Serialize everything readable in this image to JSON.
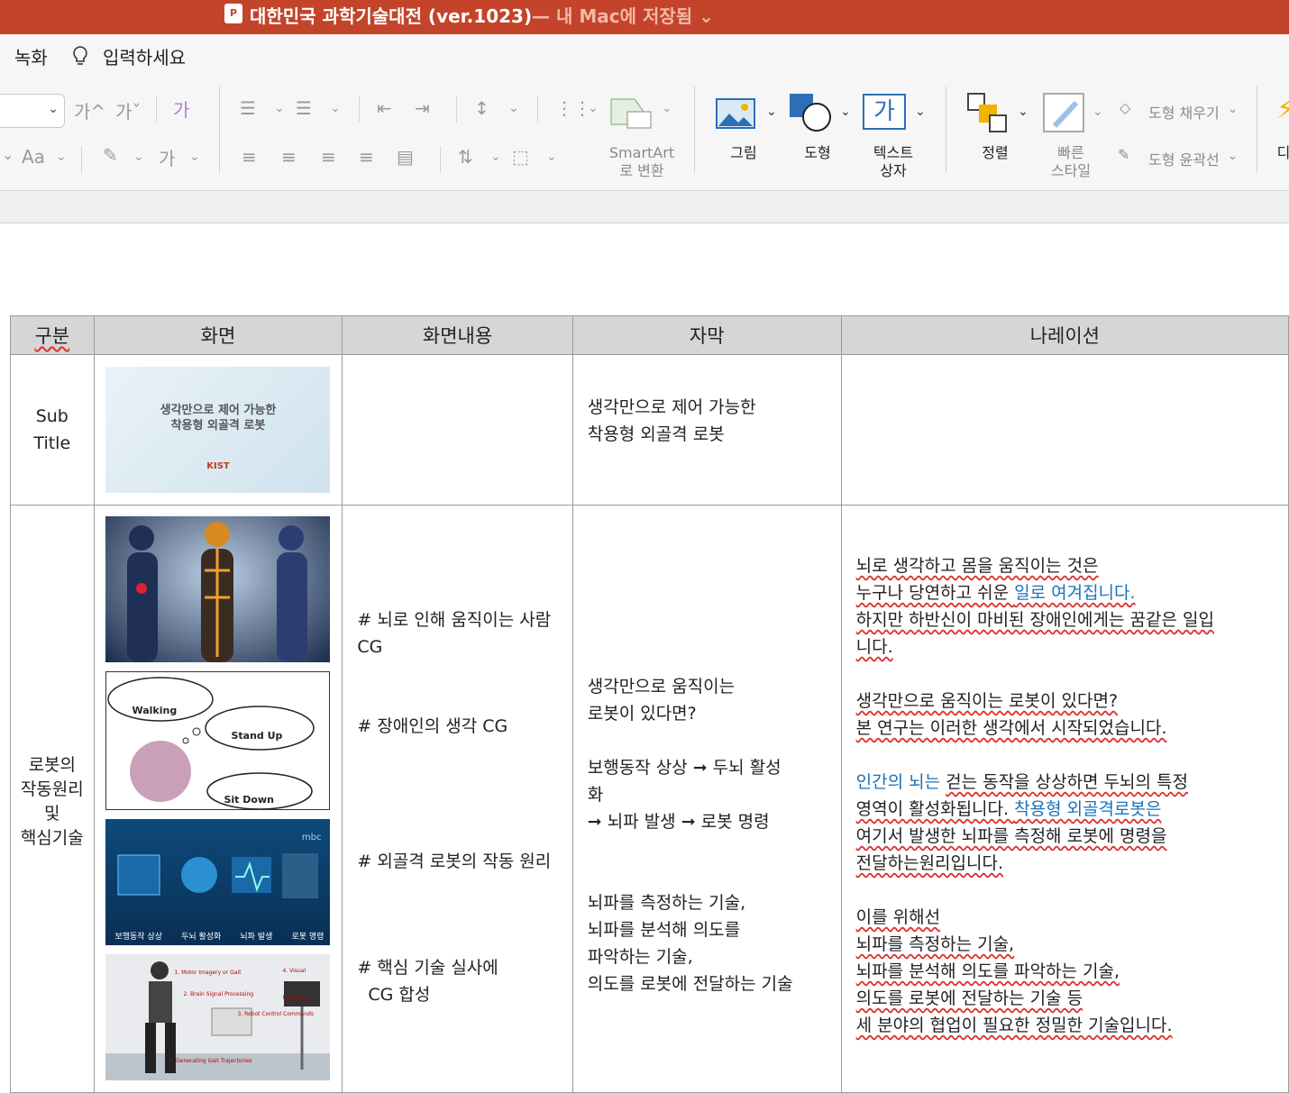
{
  "window": {
    "title": "대한민국 과학기술대전 (ver.1023)",
    "status": "— 내 Mac에 저장됨 ⌄"
  },
  "menu": {
    "record": "녹화",
    "tell_me": "입력하세요"
  },
  "ribbon": {
    "font_size_glyphs": [
      "가^",
      "가ˇ"
    ],
    "aa_label": "Aa",
    "ga_label": "가",
    "smartart": [
      "SmartArt",
      "로 변환"
    ],
    "picture": "그림",
    "shape": "도형",
    "textbox": [
      "텍스트",
      "상자"
    ],
    "textbox_glyph": "가",
    "arrange": "정렬",
    "quick_style": [
      "빠른",
      "스타일"
    ],
    "shape_fill": "도형 채우기",
    "shape_outline": "도형 윤곽선",
    "cut_label": "디"
  },
  "table": {
    "headers": [
      "구분",
      "화면",
      "화면내용",
      "자막",
      "나레이션"
    ],
    "row1": {
      "category": [
        "Sub",
        "Title"
      ],
      "thumb_text": [
        "생각만으로 제어 가능한",
        "착용형 외골격 로봇"
      ],
      "thumb_logo": "KIST",
      "subtitle": [
        "생각만으로 제어 가능한",
        "착용형 외골격 로봇"
      ]
    },
    "row2": {
      "category": [
        "로봇의",
        "작동원리",
        "및",
        "핵심기술"
      ],
      "thumb2_labels": [
        "Walking",
        "Stand Up",
        "Sit Down"
      ],
      "thumb3_labels": [
        "보행동작 상상",
        "두뇌 활성화",
        "뇌파 발생",
        "로봇 명령"
      ],
      "thumb3_brand": "mbc",
      "thumb4_labels": [
        "1. Motor Imagery or Gait",
        "2. Brain Signal Processing",
        "3. Robot Control Commands",
        "4. Visual Feedback",
        "5. Generating Gait Trajectories"
      ],
      "content": [
        "# 뇌로 인해 움직이는 사람",
        "CG",
        "# 장애인의 생각 CG",
        "# 외골격 로봇의 작동 원리",
        "# 핵심 기술 실사에",
        "CG 합성"
      ],
      "subtitle": [
        "생각만으로 움직이는",
        "로봇이 있다면?",
        "보행동작 상상 ➞ 두뇌 활성",
        "화",
        "➞ 뇌파 발생 ➞ 로봇 명령",
        "뇌파를 측정하는 기술,",
        "뇌파를 분석해 의도를",
        "파악하는 기술,",
        "의도를 로봇에 전달하는 기술"
      ],
      "narration": {
        "p1_l1": "뇌로 생각하고 몸을 움직이는 것은",
        "p1_l2a": "누구나 당연하고 쉬운 ",
        "p1_l2b": "일로 여겨집니다.",
        "p1_l3": "하지만 하반신이 마비된 장애인에게는 꿈같은 일입",
        "p1_l4": "니다.",
        "p2_l1": "생각만으로 움직이는 로봇이 있다면?",
        "p2_l2": "본 연구는 이러한 생각에서 시작되었습니다.",
        "p3_l1a": "인간의 뇌는 ",
        "p3_l1b": "걷는 동작을 상상하면 두뇌의 특정",
        "p3_l2a": "영역이 활성화됩니다.  ",
        "p3_l2b": "착용형 외골격로봇은",
        "p3_l3": "여기서 발생한 뇌파를 측정해 로봇에 명령을",
        "p3_l4": "전달하는원리입니다.",
        "p4_l1": "이를 위해선",
        "p4_l2": "뇌파를 측정하는 기술,",
        "p4_l3": "뇌파를 분석해 의도를 파악하는 기술,",
        "p4_l4": "의도를 로봇에 전달하는 기술 등",
        "p4_l5": "세 분야의 협업이 필요한 정밀한 기술입니다."
      }
    }
  },
  "colors": {
    "titlebar": "#c3442a",
    "accent_blue": "#1a72b8",
    "squiggle": "#d33"
  }
}
